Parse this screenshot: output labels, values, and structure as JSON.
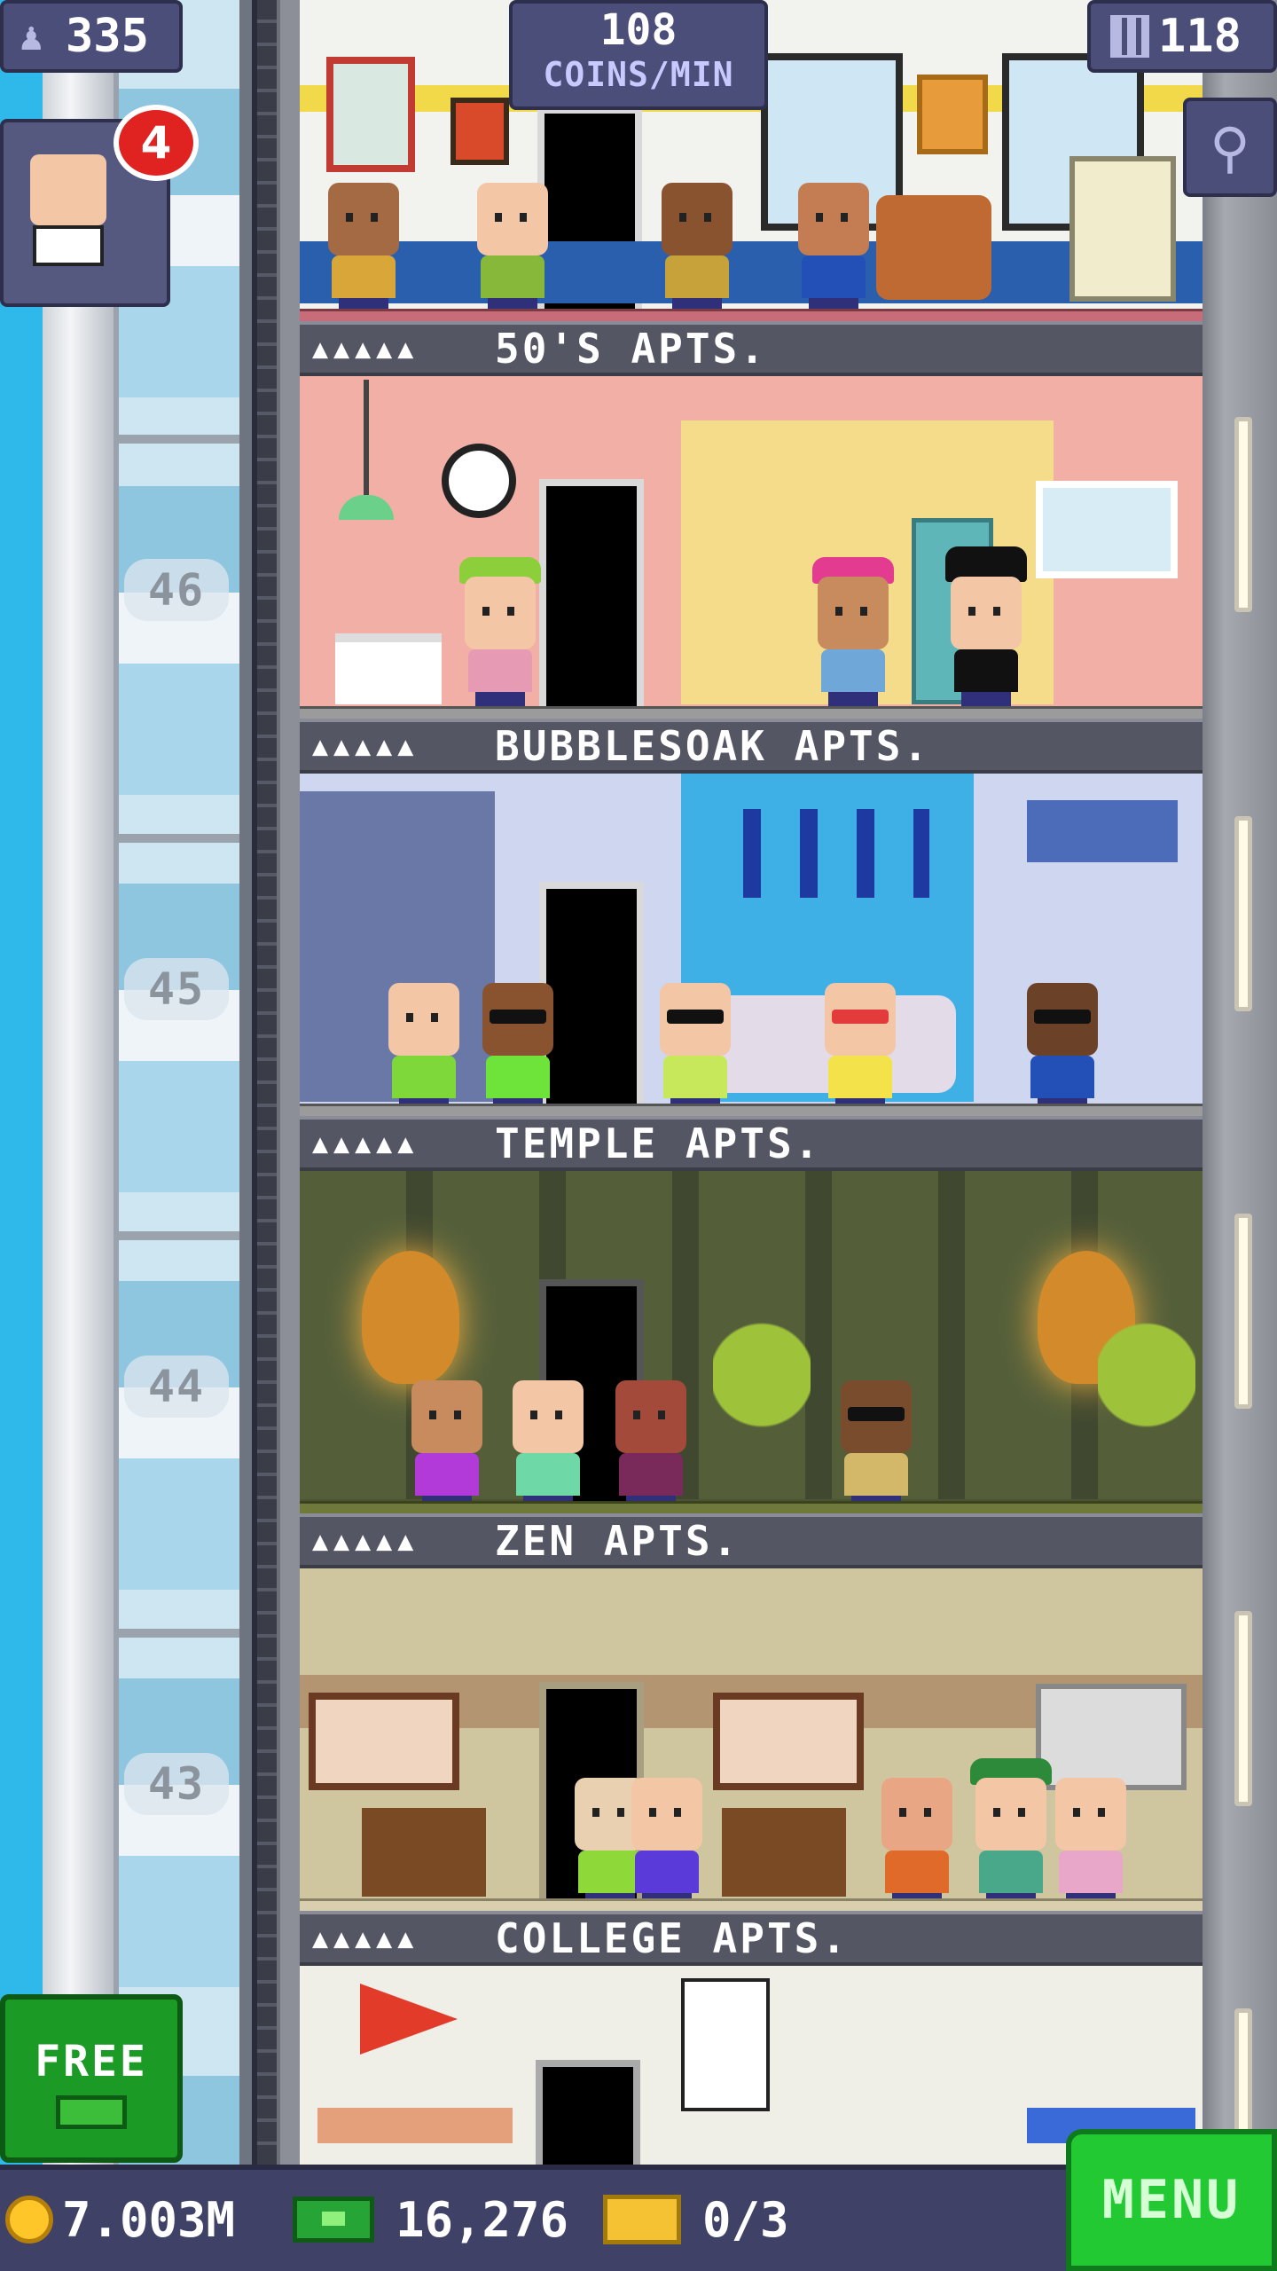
{
  "hud": {
    "population": "335",
    "coin_rate_value": "108",
    "coin_rate_unit": "COINS/MIN",
    "floor_count": "118",
    "visitor_badge": "4"
  },
  "floors": [
    {
      "name": "50'S APTS.",
      "stars": "▲▲▲▲▲"
    },
    {
      "name": "BUBBLESOAK APTS.",
      "stars": "▲▲▲▲▲"
    },
    {
      "name": "TEMPLE APTS.",
      "stars": "▲▲▲▲▲"
    },
    {
      "name": "ZEN APTS.",
      "stars": "▲▲▲▲▲"
    },
    {
      "name": "COLLEGE APTS.",
      "stars": "▲▲▲▲▲"
    }
  ],
  "shaft": {
    "floor_numbers": [
      "46",
      "45",
      "44",
      "43"
    ]
  },
  "footer": {
    "coins": "7.003M",
    "bux": "16,276",
    "tickets": "0/3",
    "free_label": "FREE",
    "menu_label": "MENU"
  },
  "icons": {
    "population": "person-icon",
    "floors": "building-icon",
    "search": "magnifier-icon",
    "coin": "coin-icon",
    "bux": "bux-icon",
    "ticket": "vip-ticket-icon"
  },
  "colors": {
    "hud_panel": "#4b4e79",
    "menu_green": "#23c932",
    "free_green": "#1c9a26",
    "badge_red": "#e02320",
    "sky_blue": "#2fb8ea"
  }
}
